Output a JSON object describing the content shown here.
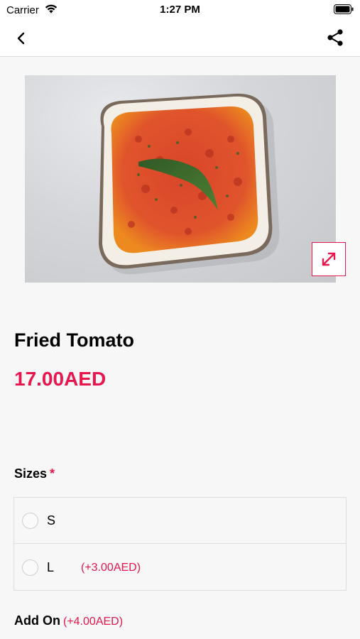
{
  "status_bar": {
    "carrier": "Carrier",
    "time": "1:27 PM"
  },
  "nav": {
    "back_icon": "chevron-left-icon",
    "share_icon": "share-icon"
  },
  "product": {
    "image_alt": "Fried Tomato dish",
    "title": "Fried Tomato",
    "price": "17.00AED"
  },
  "sizes": {
    "heading": "Sizes",
    "required": "*",
    "options": [
      {
        "label": "S",
        "extra": ""
      },
      {
        "label": "L",
        "extra": "(+3.00AED)"
      }
    ]
  },
  "addon": {
    "heading": "Add On",
    "price": "(+4.00AED)"
  },
  "colors": {
    "accent": "#e8164d",
    "background": "#f7f7f7"
  }
}
